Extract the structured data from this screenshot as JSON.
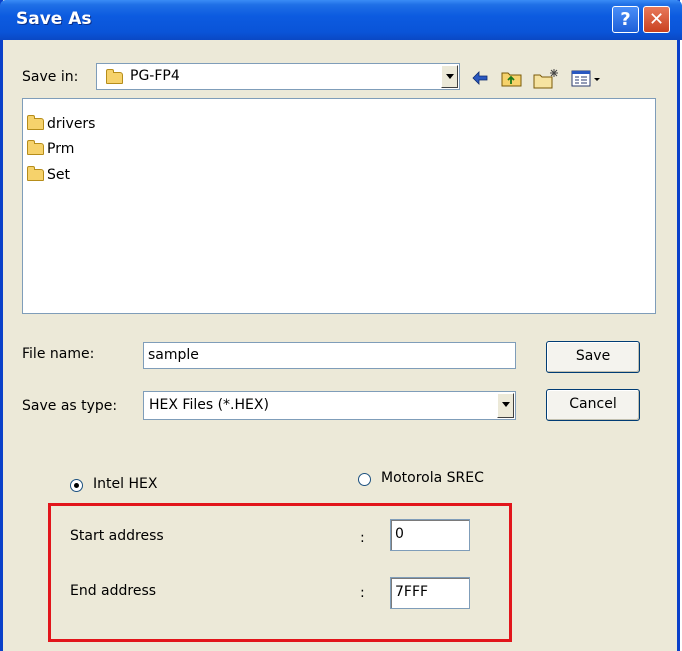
{
  "window": {
    "title": "Save As",
    "help_label": "?",
    "close_label": "✕"
  },
  "save_in": {
    "label": "Save in:",
    "folder": "PG-FP4"
  },
  "toolbar": {
    "icons": [
      "back-icon",
      "up-folder-icon",
      "new-folder-icon",
      "view-menu-icon"
    ]
  },
  "files": [
    {
      "name": "drivers",
      "type": "folder"
    },
    {
      "name": "Prm",
      "type": "folder"
    },
    {
      "name": "Set",
      "type": "folder"
    }
  ],
  "file_name": {
    "label": "File name:",
    "value": "sample"
  },
  "save_as_type": {
    "label": "Save as type:",
    "value": "HEX Files (*.HEX)"
  },
  "buttons": {
    "save": "Save",
    "cancel": "Cancel"
  },
  "format": {
    "options": [
      {
        "label": "Intel HEX",
        "selected": true
      },
      {
        "label": "Motorola SREC",
        "selected": false
      }
    ]
  },
  "address": {
    "start_label": "Start address",
    "end_label": "End address",
    "separator": ":",
    "start_value": "0",
    "end_value": "7FFF"
  },
  "colors": {
    "title_bar": "#0a54d8",
    "highlight_box": "#e2151b",
    "dialog_bg": "#ece9d8"
  }
}
